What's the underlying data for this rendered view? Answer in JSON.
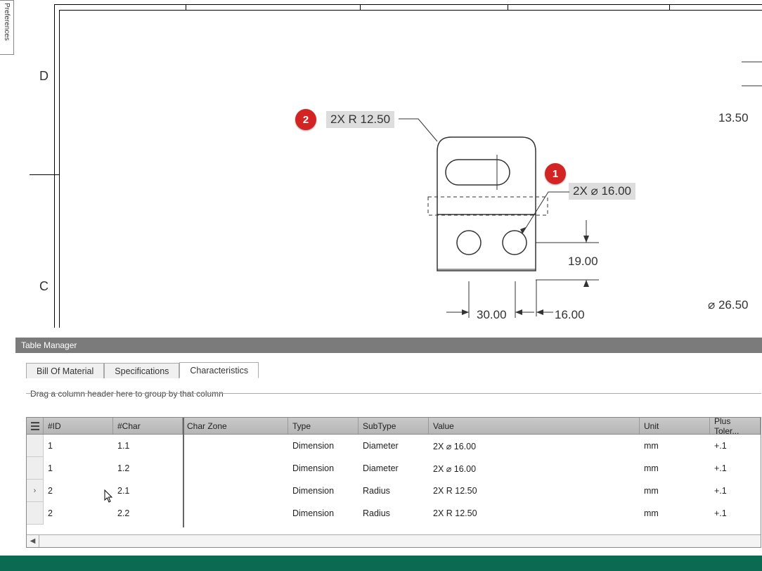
{
  "sidebar": {
    "preferences_label": "Preferences"
  },
  "zones": {
    "D": "D",
    "C": "C"
  },
  "balloons": {
    "b1": {
      "num": "1",
      "text": "2X ⌀ 16.00"
    },
    "b2": {
      "num": "2",
      "text": "2X R 12.50"
    }
  },
  "dims": {
    "d1": "19.00",
    "d2": "30.00",
    "d3": "16.00",
    "d4": "13.50",
    "d5": "⌀ 26.50"
  },
  "table_manager": {
    "title": "Table Manager",
    "tabs": {
      "bom": "Bill Of Material",
      "spec": "Specifications",
      "char": "Characteristics"
    },
    "group_hint": "Drag a column header here to group by that column",
    "columns": {
      "id": "#ID",
      "char": "#Char",
      "zone": "Char Zone",
      "type": "Type",
      "subtype": "SubType",
      "value": "Value",
      "unit": "Unit",
      "plus": "Plus Toler..."
    },
    "rows": [
      {
        "id": "1",
        "char": "1.1",
        "zone": "",
        "type": "Dimension",
        "subtype": "Diameter",
        "value": "2X ⌀ 16.00",
        "unit": "mm",
        "plus": "+.1"
      },
      {
        "id": "1",
        "char": "1.2",
        "zone": "",
        "type": "Dimension",
        "subtype": "Diameter",
        "value": "2X ⌀ 16.00",
        "unit": "mm",
        "plus": "+.1"
      },
      {
        "id": "2",
        "char": "2.1",
        "zone": "",
        "type": "Dimension",
        "subtype": "Radius",
        "value": "2X R 12.50",
        "unit": "mm",
        "plus": "+.1"
      },
      {
        "id": "2",
        "char": "2.2",
        "zone": "",
        "type": "Dimension",
        "subtype": "Radius",
        "value": "2X R 12.50",
        "unit": "mm",
        "plus": "+.1"
      }
    ]
  }
}
